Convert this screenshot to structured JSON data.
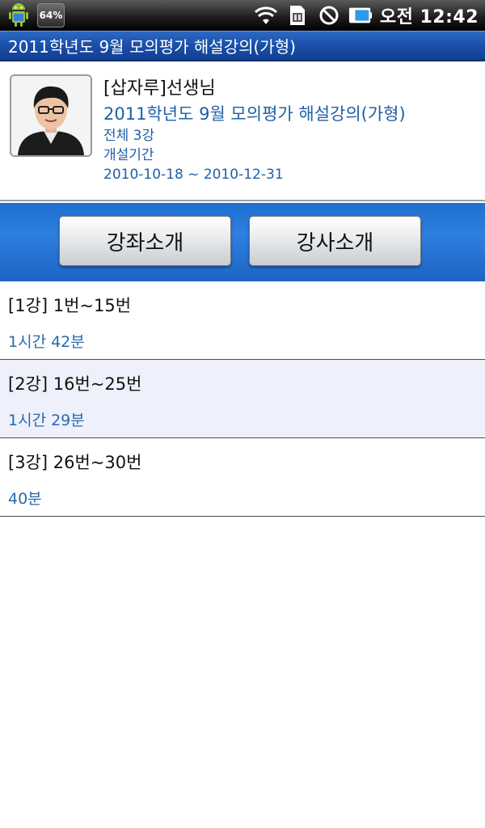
{
  "status_bar": {
    "battery_percent": "64%",
    "clock": "오전 12:42",
    "icons": [
      "android-icon",
      "wifi-icon",
      "sim-icon",
      "no-sign-icon",
      "battery-icon"
    ]
  },
  "title_bar": {
    "title": "2011학년도 9월 모의평가 해설강의(가형)"
  },
  "course_info": {
    "teacher": "[삽자루]선생님",
    "course_title": "2011학년도 9월 모의평가 해설강의(가형)",
    "total_lectures": "전체 3강",
    "period_label": "개설기간",
    "period": "2010-10-18 ~ 2010-12-31"
  },
  "buttons": {
    "course_intro": "강좌소개",
    "teacher_intro": "강사소개"
  },
  "lectures": [
    {
      "title": "[1강] 1번~15번",
      "duration": "1시간 42분"
    },
    {
      "title": "[2강] 16번~25번",
      "duration": "1시간 29분"
    },
    {
      "title": "[3강] 26번~30번",
      "duration": "40분"
    }
  ],
  "colors": {
    "title_bar": "#1a4fa8",
    "accent_text": "#1f5fa8",
    "button_band": "#2f7fe0",
    "alt_row": "#eef0fc"
  }
}
